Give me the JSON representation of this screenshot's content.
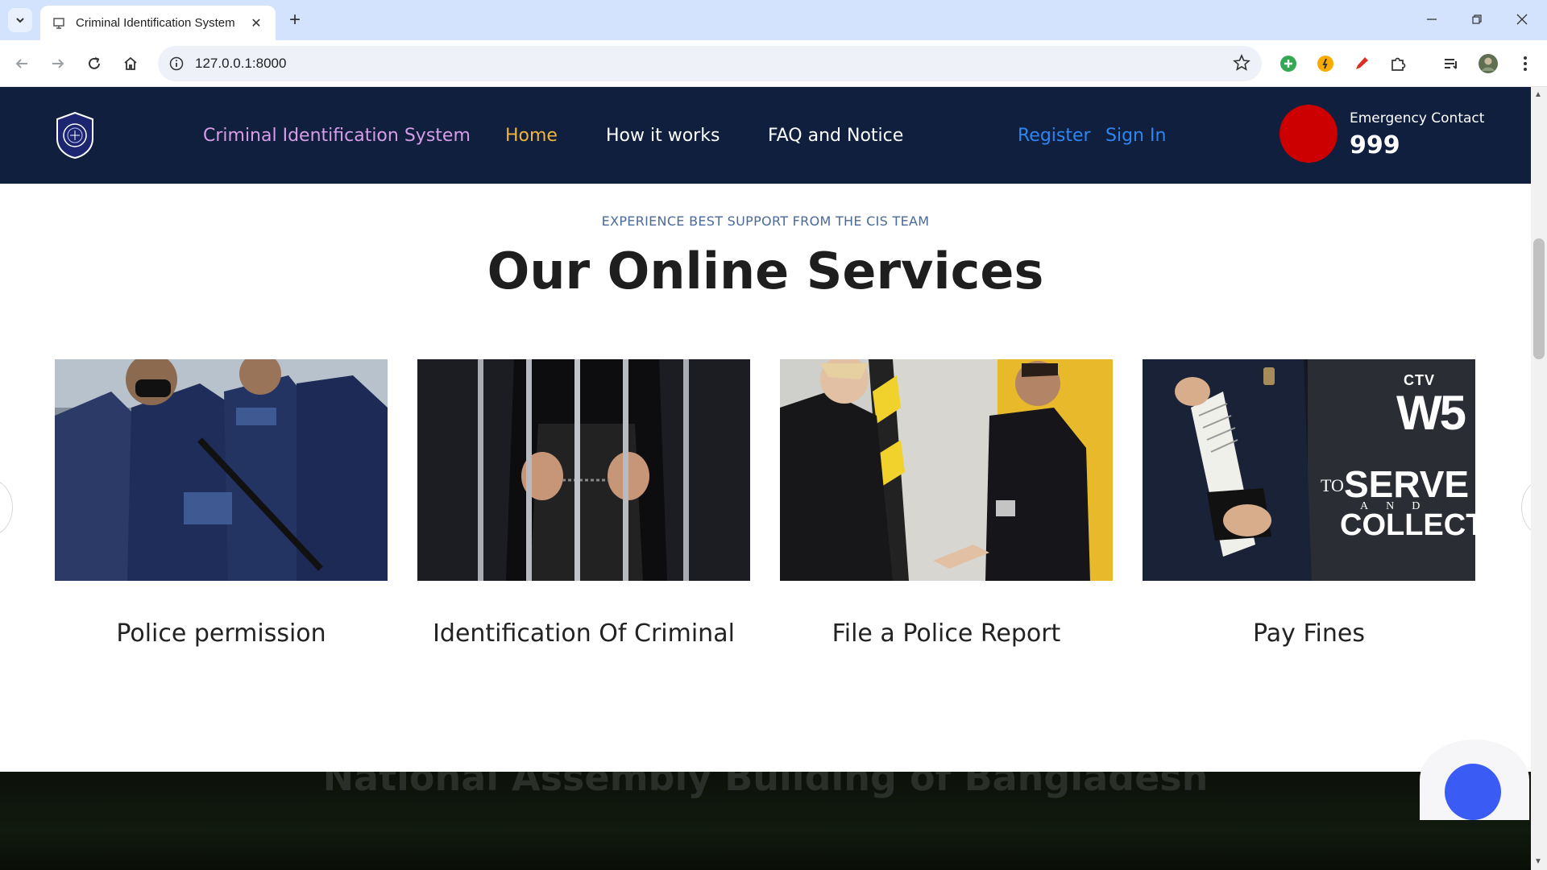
{
  "browser": {
    "tab_title": "Criminal Identification System",
    "url": "127.0.0.1:8000"
  },
  "header": {
    "brand": "Criminal Identification System",
    "nav": [
      {
        "label": "Home",
        "active": true
      },
      {
        "label": "How it works",
        "active": false
      },
      {
        "label": "FAQ and Notice",
        "active": false
      }
    ],
    "register": "Register",
    "sign_in": "Sign In",
    "emergency_label": "Emergency Contact",
    "emergency_number": "999"
  },
  "services": {
    "eyebrow": "EXPERIENCE BEST SUPPORT FROM THE CIS TEAM",
    "title": "Our Online Services",
    "cards": [
      {
        "title": "Police permission"
      },
      {
        "title": "Identification Of Criminal"
      },
      {
        "title": "File a Police Report"
      },
      {
        "title": "Pay Fines",
        "image_text": {
          "brand": "CTV",
          "show": "W5",
          "line1_small": "TO",
          "line1": "SERVE",
          "line2": "AND",
          "line3": "COLLECT"
        }
      }
    ]
  },
  "banner": {
    "text": "National Assembly Building of Bangladesh"
  },
  "colors": {
    "header_bg": "#0f1f3d",
    "brand": "#d79de8",
    "active_nav": "#f2b43c",
    "auth_link": "#2e86f2",
    "emergency": "#cc0000",
    "float_button": "#3b5bf5"
  }
}
